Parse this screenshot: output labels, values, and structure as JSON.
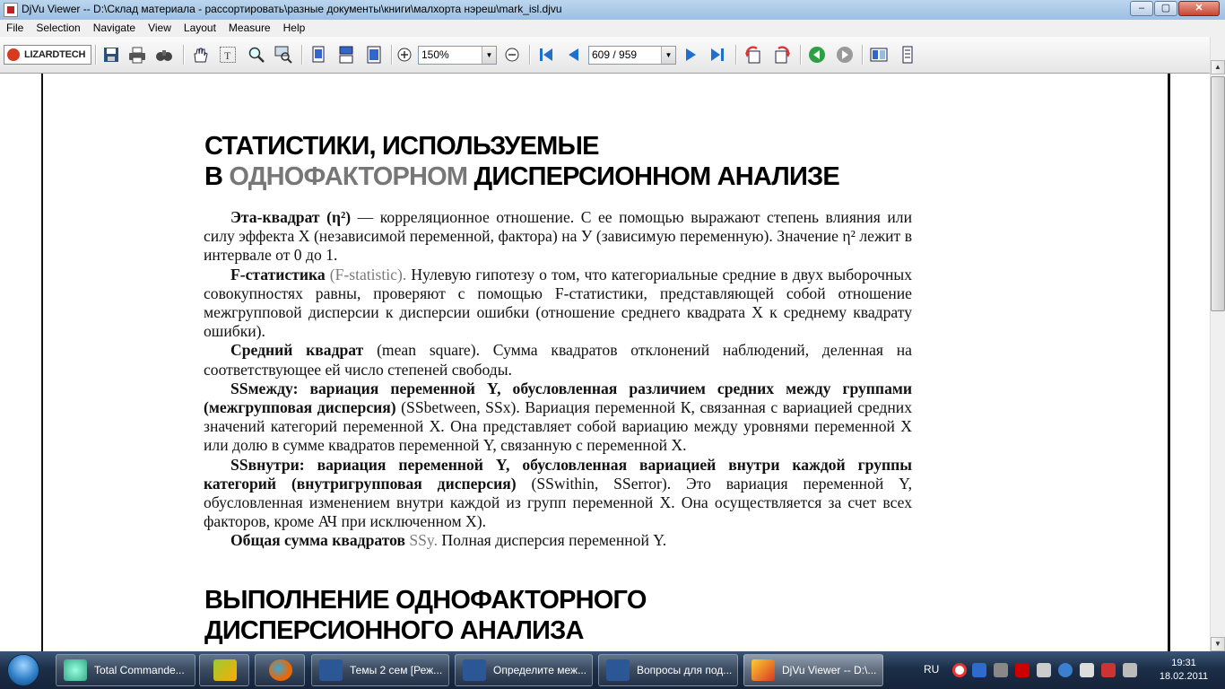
{
  "window": {
    "title": "DjVu Viewer -- D:\\Склад материала - рассортировать\\разные документы\\книги\\малхорта нэреш\\mark_isl.djvu",
    "min_label": "‒",
    "max_label": "▢",
    "close_label": "✕"
  },
  "menu": [
    "File",
    "Selection",
    "Navigate",
    "View",
    "Layout",
    "Measure",
    "Help"
  ],
  "toolbar": {
    "logo_text": "LIZARDTECH",
    "zoom_value": "150%",
    "page_value": "609 / 959",
    "dropdown_arrow": "▼"
  },
  "document": {
    "heading1_line1": "СТАТИСТИКИ,  ИСПОЛЬЗУЕМЫЕ",
    "heading1_prefix": "В ",
    "heading1_grey": "ОДНОФАКТОРНОМ",
    "heading1_suffix": " ДИСПЕРСИОННОМ АНАЛИЗЕ",
    "p1_term": "Эта-квадрат (η²)",
    "p1_text": " — корреляционное отношение. С ее помощью выражают степень влияния или силу эффекта X (независимой переменной, фактора) на У (зависимую переменную). Значение η² лежит в интервале от 0 до 1.",
    "p2_term": "F-статистика",
    "p2_grey": " (F-statistic).",
    "p2_text": " Нулевую гипотезу о том, что категориальные средние в двух выборочных совокупностях равны, проверяют с помощью F-статистики, представляющей собой отношение межгрупповой дисперсии к дисперсии ошибки (отношение среднего квадрата X к среднему квадрату ошибки).",
    "p3_term": "Средний квадрат",
    "p3_text": " (mean square). Сумма квадратов отклонений наблюдений, деленная на соответствующее ей число степеней свободы.",
    "p4_term": "SSмежду: вариация переменной Y, обусловленная различием средних между группами (межгрупповая дисперсия)",
    "p4_text": " (SSbetween, SSx). Вариация переменной К, связанная с вариацией средних значений категорий переменной X. Она представляет собой вариацию между уровнями переменной X или долю в сумме квадратов переменной Y, связанную с переменной X.",
    "p5_term": "SSвнутри: вариация переменной Y, обусловленная вариацией внутри каждой группы категорий (внутригрупповая дисперсия)",
    "p5_text": " (SSwithin, SSerror). Это вариация переменной Y, обусловленная изменением внутри каждой из групп переменной X. Она осуществляется за счет всех факторов, кроме АЧ при исключенном X).",
    "p6_term": "Общая сумма квадратов",
    "p6_grey": " SSy.",
    "p6_text": " Полная дисперсия переменной Y.",
    "heading2_line1": "ВЫПОЛНЕНИЕ  ОДНОФАКТОРНОГО",
    "heading2_line2": "ДИСПЕРСИОННОГО АНАЛИЗА"
  },
  "taskbar": {
    "tasks": [
      {
        "label": "Total Commande...",
        "icon": "total-commander-icon"
      },
      {
        "label": "",
        "icon": "butterfly-icon"
      },
      {
        "label": "",
        "icon": "firefox-icon"
      },
      {
        "label": "Темы 2 сем [Реж...",
        "icon": "word-icon"
      },
      {
        "label": "Определите меж...",
        "icon": "word-icon"
      },
      {
        "label": "Вопросы для под...",
        "icon": "word-icon"
      },
      {
        "label": "DjVu Viewer -- D:\\...",
        "icon": "djvu-icon"
      }
    ],
    "lang": "RU",
    "time": "19:31",
    "date": "18.02.2011"
  },
  "colors": {
    "accent_red": "#d63b1f",
    "word_blue": "#2b5797",
    "nav_blue": "#1f6fd1",
    "green": "#2ea043"
  }
}
